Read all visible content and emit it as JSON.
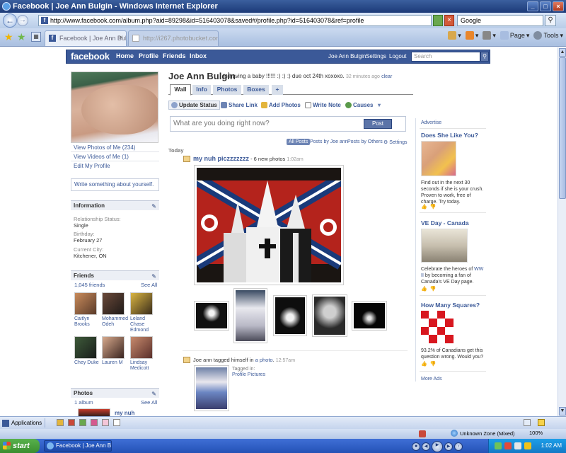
{
  "window": {
    "title": "Facebook | Joe Ann Bulgin - Windows Internet Explorer",
    "url": "http://www.facebook.com/album.php?aid=89298&id=516403078&saved#/profile.php?id=516403078&ref=profile",
    "search_engine": "Google"
  },
  "tabs": [
    {
      "label": "Facebook | Joe Ann Bulgin",
      "active": true
    },
    {
      "label": "http://i267.photobucket.com/...",
      "active": false
    }
  ],
  "command_bar": {
    "page": "Page",
    "tools": "Tools"
  },
  "fb_header": {
    "logo": "facebook",
    "nav": [
      "Home",
      "Profile",
      "Friends",
      "Inbox"
    ],
    "right_links": [
      "Joe Ann Bulgin",
      "Settings",
      "Logout"
    ],
    "search_placeholder": "Search"
  },
  "left_column": {
    "links": [
      "View Photos of Me (234)",
      "View Videos of Me (1)",
      "Edit My Profile"
    ],
    "write_about": "Write something about yourself.",
    "information": {
      "title": "Information",
      "relationship_label": "Relationship Status:",
      "relationship_value": "Single",
      "birthday_label": "Birthday:",
      "birthday_value": "February 27",
      "city_label": "Current City:",
      "city_value": "Kitchener, ON"
    },
    "friends": {
      "title": "Friends",
      "count": "1,045 friends",
      "see_all": "See All",
      "names": [
        "Caitlyn Brooks",
        "Mohammed Odeh",
        "Leland Chase Edmond",
        "Chey Duke",
        "Lauren M",
        "Lindsay Medicott"
      ]
    },
    "photos": {
      "title": "Photos",
      "count": "1 album",
      "see_all": "See All",
      "album_name": "my nuh"
    }
  },
  "profile": {
    "name": "Joe Ann Bulgin",
    "status": "is having a baby !!!!!! :) :) :) due oct 24th xoxoxo.",
    "status_time": "32 minutes ago",
    "status_clear": "clear",
    "tabs": [
      "Wall",
      "Info",
      "Photos",
      "Boxes",
      "+"
    ],
    "active_tab": "Wall"
  },
  "publisher": {
    "actions": [
      "Update Status",
      "Share Link",
      "Add Photos",
      "Write Note",
      "Causes"
    ],
    "placeholder": "What are you doing right now?",
    "post_button": "Post"
  },
  "wall_filters": {
    "items": [
      "All Posts",
      "Posts by Joe ann",
      "Posts by Others",
      "Settings"
    ],
    "active": "All Posts"
  },
  "feed": {
    "section": "Today",
    "story1": {
      "actor": "my nuh piczzzzzzz",
      "meta": " - 6 new photos ",
      "time": "1:02am"
    },
    "story2": {
      "actor": "Joe ann",
      "text": " tagged himself in ",
      "link": "a photo",
      "time": "12:57am",
      "tagged_in_label": "Tagged in:",
      "tagged_in_link": "Profile Pictures"
    }
  },
  "ads": {
    "advertise": "Advertise",
    "items": [
      {
        "title": "Does She Like You?",
        "body": "Find out in the next 30 seconds if she is your crush. Proven to work, free of charge. Try today."
      },
      {
        "title": "VE Day - Canada",
        "body_start": "Celebrate the heroes of ",
        "body_link": "WW II",
        "body_end": " by becoming a fan of Canada's VE Day page."
      },
      {
        "title": "How Many Squares?",
        "body": "93.2% of Canadians get this question wrong. Would you?"
      }
    ],
    "more_ads": "More Ads"
  },
  "status_bar": {
    "applications": "Applications",
    "zone": "Unknown Zone (Mixed)",
    "zoom": "100%"
  },
  "taskbar": {
    "start": "start",
    "app": "Facebook | Joe Ann B...",
    "clock": "1:02 AM"
  },
  "colors": {
    "fb_blue": "#3b5998",
    "fb_header_border": "#29447e",
    "link": "#3b5998"
  }
}
